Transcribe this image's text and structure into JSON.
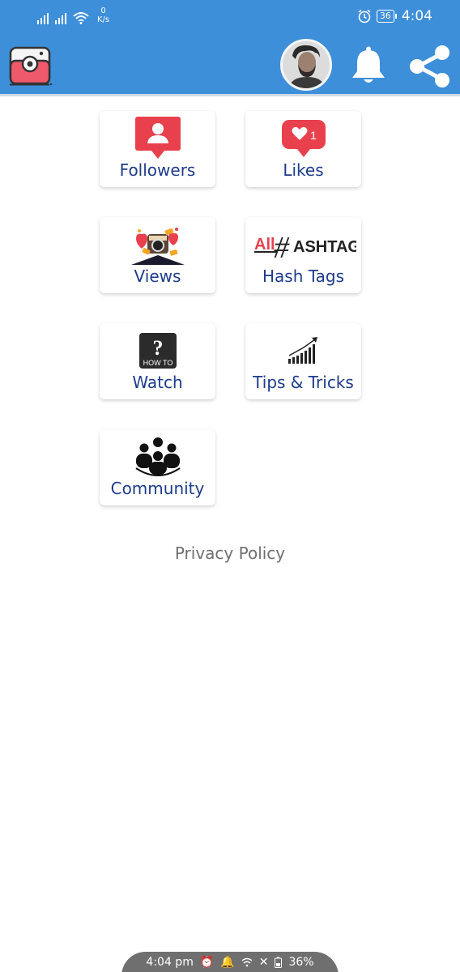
{
  "status_bar": {
    "speed_value": "0",
    "speed_unit": "K/s",
    "battery": "36",
    "time": "4:04",
    "icons": [
      "signal-icon",
      "signal-icon",
      "wifi-icon",
      "alarm-icon",
      "battery-icon"
    ]
  },
  "app_bar": {
    "icons": [
      "app-logo-icon",
      "avatar",
      "bell-icon",
      "share-icon"
    ],
    "colors": {
      "bar": "#3d8fd9",
      "logo": "#ee5a6c"
    }
  },
  "tiles": [
    {
      "label": "Followers",
      "icon": "followers-icon"
    },
    {
      "label": "Likes",
      "icon": "likes-icon",
      "badge": "1"
    },
    {
      "label": "Views",
      "icon": "views-icon"
    },
    {
      "label": "Hash Tags",
      "icon": "hashtag-icon",
      "icon_text_all": "All",
      "icon_text_hash": "#",
      "icon_text_rest": "ASHTAG"
    },
    {
      "label": "Watch",
      "icon": "howto-icon",
      "icon_text_q": "?",
      "icon_text": "HOW TO"
    },
    {
      "label": "Tips & Tricks",
      "icon": "growth-chart-icon"
    },
    {
      "label": "Community",
      "icon": "community-icon"
    }
  ],
  "privacy_policy": "Privacy Policy",
  "bottom_bar": {
    "time": "4:04 pm",
    "battery": "36%",
    "icons": [
      "alarm-icon",
      "bell-icon",
      "wifi-icon",
      "no-data-icon",
      "battery-icon"
    ]
  },
  "colors": {
    "label": "#1e3c8c",
    "red": "#e8414d",
    "privacy": "#707070"
  }
}
